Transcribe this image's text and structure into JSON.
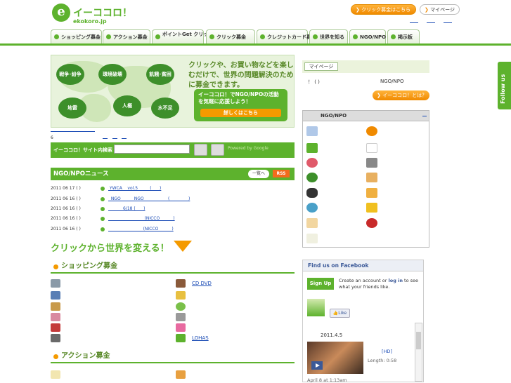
{
  "header": {
    "logo_letter": "e",
    "logo_title": "イーココロ！",
    "logo_sub": "ekokoro.jp",
    "click_button": "クリック募金はこちら",
    "mypage_button": "マイページ"
  },
  "nav": {
    "tabs": [
      {
        "label": "ショッピング募金"
      },
      {
        "label": "アクション募金"
      },
      {
        "label": "ポイントGet クリック募金"
      },
      {
        "label": "クリック募金"
      },
      {
        "label": "クレジットカード募金"
      },
      {
        "label": "世界を知る"
      },
      {
        "label": "NGO/NPO"
      },
      {
        "label": "掲示板"
      }
    ]
  },
  "banner": {
    "bubbles": [
      "戦争･紛争",
      "環境破壊",
      "飢餓･貧困",
      "地雷",
      "人権",
      "水不足"
    ],
    "headline": "クリックや、お買い物などを楽しむだけで、世界の問題解決のために募金できます。",
    "box_text": "イーココロ！でNGO/NPOの活動を気軽に応援しよう！",
    "box_button": "詳しくはこちら"
  },
  "misc": {
    "number": "6"
  },
  "search": {
    "label": "イーココロ！サイト内検索",
    "extra": "Powered by Google"
  },
  "news": {
    "title": "NGO/NPOニュース",
    "more": "一覧へ",
    "rss": "RSS",
    "items": [
      {
        "date": "2011 06 17 ( )",
        "title": " YWCA    vol.5         (      )"
      },
      {
        "date": "2011 06 16 ( )",
        "title": "  NGO          NGO                  (              )"
      },
      {
        "date": "2011 06 16 ( )",
        "title": "           6/18 (      )"
      },
      {
        "date": "2011 06 16 ( )",
        "title": "                           (NICCO          )"
      },
      {
        "date": "2011 06 16 ( )",
        "title": "                          (NICCO          )"
      }
    ]
  },
  "change_title": "クリックから世界を変える！",
  "shopping": {
    "heading": "ショッピング募金",
    "left": [
      " ",
      " ",
      " ",
      " ",
      " ",
      " "
    ],
    "right": [
      "  CD DVD",
      " ",
      " ",
      " ",
      " ",
      "     LOHAS"
    ]
  },
  "action": {
    "heading": "アクション募金"
  },
  "mypage": {
    "label": "マイページ",
    "info": "！ ( )",
    "ngo_text": "NGO/NPO",
    "whatis_button": "イーココロ！とは？"
  },
  "ngo_panel": {
    "title": "NGO/NPO"
  },
  "facebook": {
    "title": "Find us on Facebook",
    "signup": "Sign Up",
    "text_pre": "Create an account or ",
    "login": "log in",
    "text_post": " to see what your friends like.",
    "like": "Like",
    "date": "2011.4.5",
    "hd": "[HD]",
    "length": "Length:  0:58",
    "posted": "April 8 at 1:13am"
  },
  "follow": "Follow us"
}
